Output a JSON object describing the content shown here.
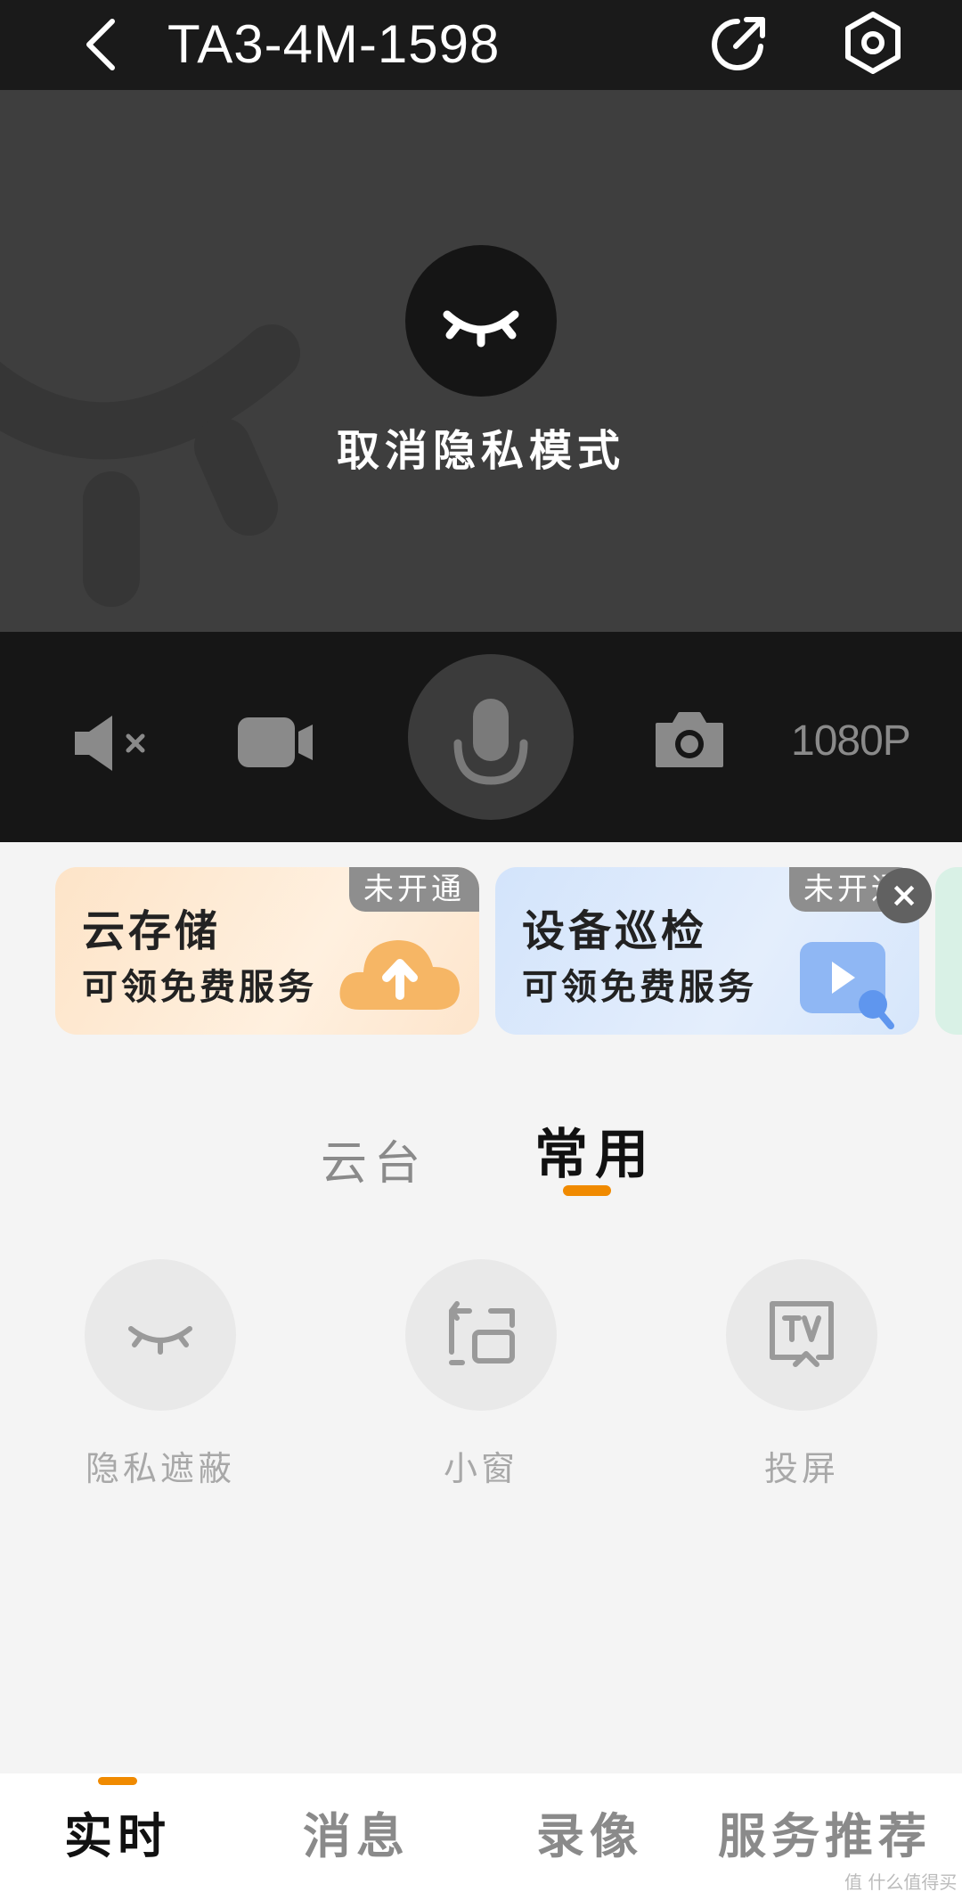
{
  "header": {
    "device_name": "TA3-4M-1598"
  },
  "privacy": {
    "action_label": "取消隐私模式"
  },
  "controls": {
    "quality_label": "1080P"
  },
  "promos": [
    {
      "title": "云存储",
      "subtitle": "可领免费服务",
      "badge": "未开通",
      "icon": "cloud-upload-icon"
    },
    {
      "title": "设备巡检",
      "subtitle": "可领免费服务",
      "badge": "未开通",
      "icon": "play-search-icon"
    }
  ],
  "tabs": [
    {
      "label": "云台",
      "active": false
    },
    {
      "label": "常用",
      "active": true
    }
  ],
  "tools": [
    {
      "label": "隐私遮蔽",
      "icon": "closed-eye-icon"
    },
    {
      "label": "小窗",
      "icon": "small-window-icon"
    },
    {
      "label": "投屏",
      "icon": "tv-cast-icon"
    }
  ],
  "bottom_nav": [
    {
      "label": "实时",
      "active": true
    },
    {
      "label": "消息",
      "active": false
    },
    {
      "label": "录像",
      "active": false
    },
    {
      "label": "服务推荐",
      "active": false
    }
  ],
  "watermark": "值 什么值得买",
  "colors": {
    "accent": "#f08a00",
    "header_bg": "#1a1a1a",
    "video_bg": "#3e3e3e"
  }
}
